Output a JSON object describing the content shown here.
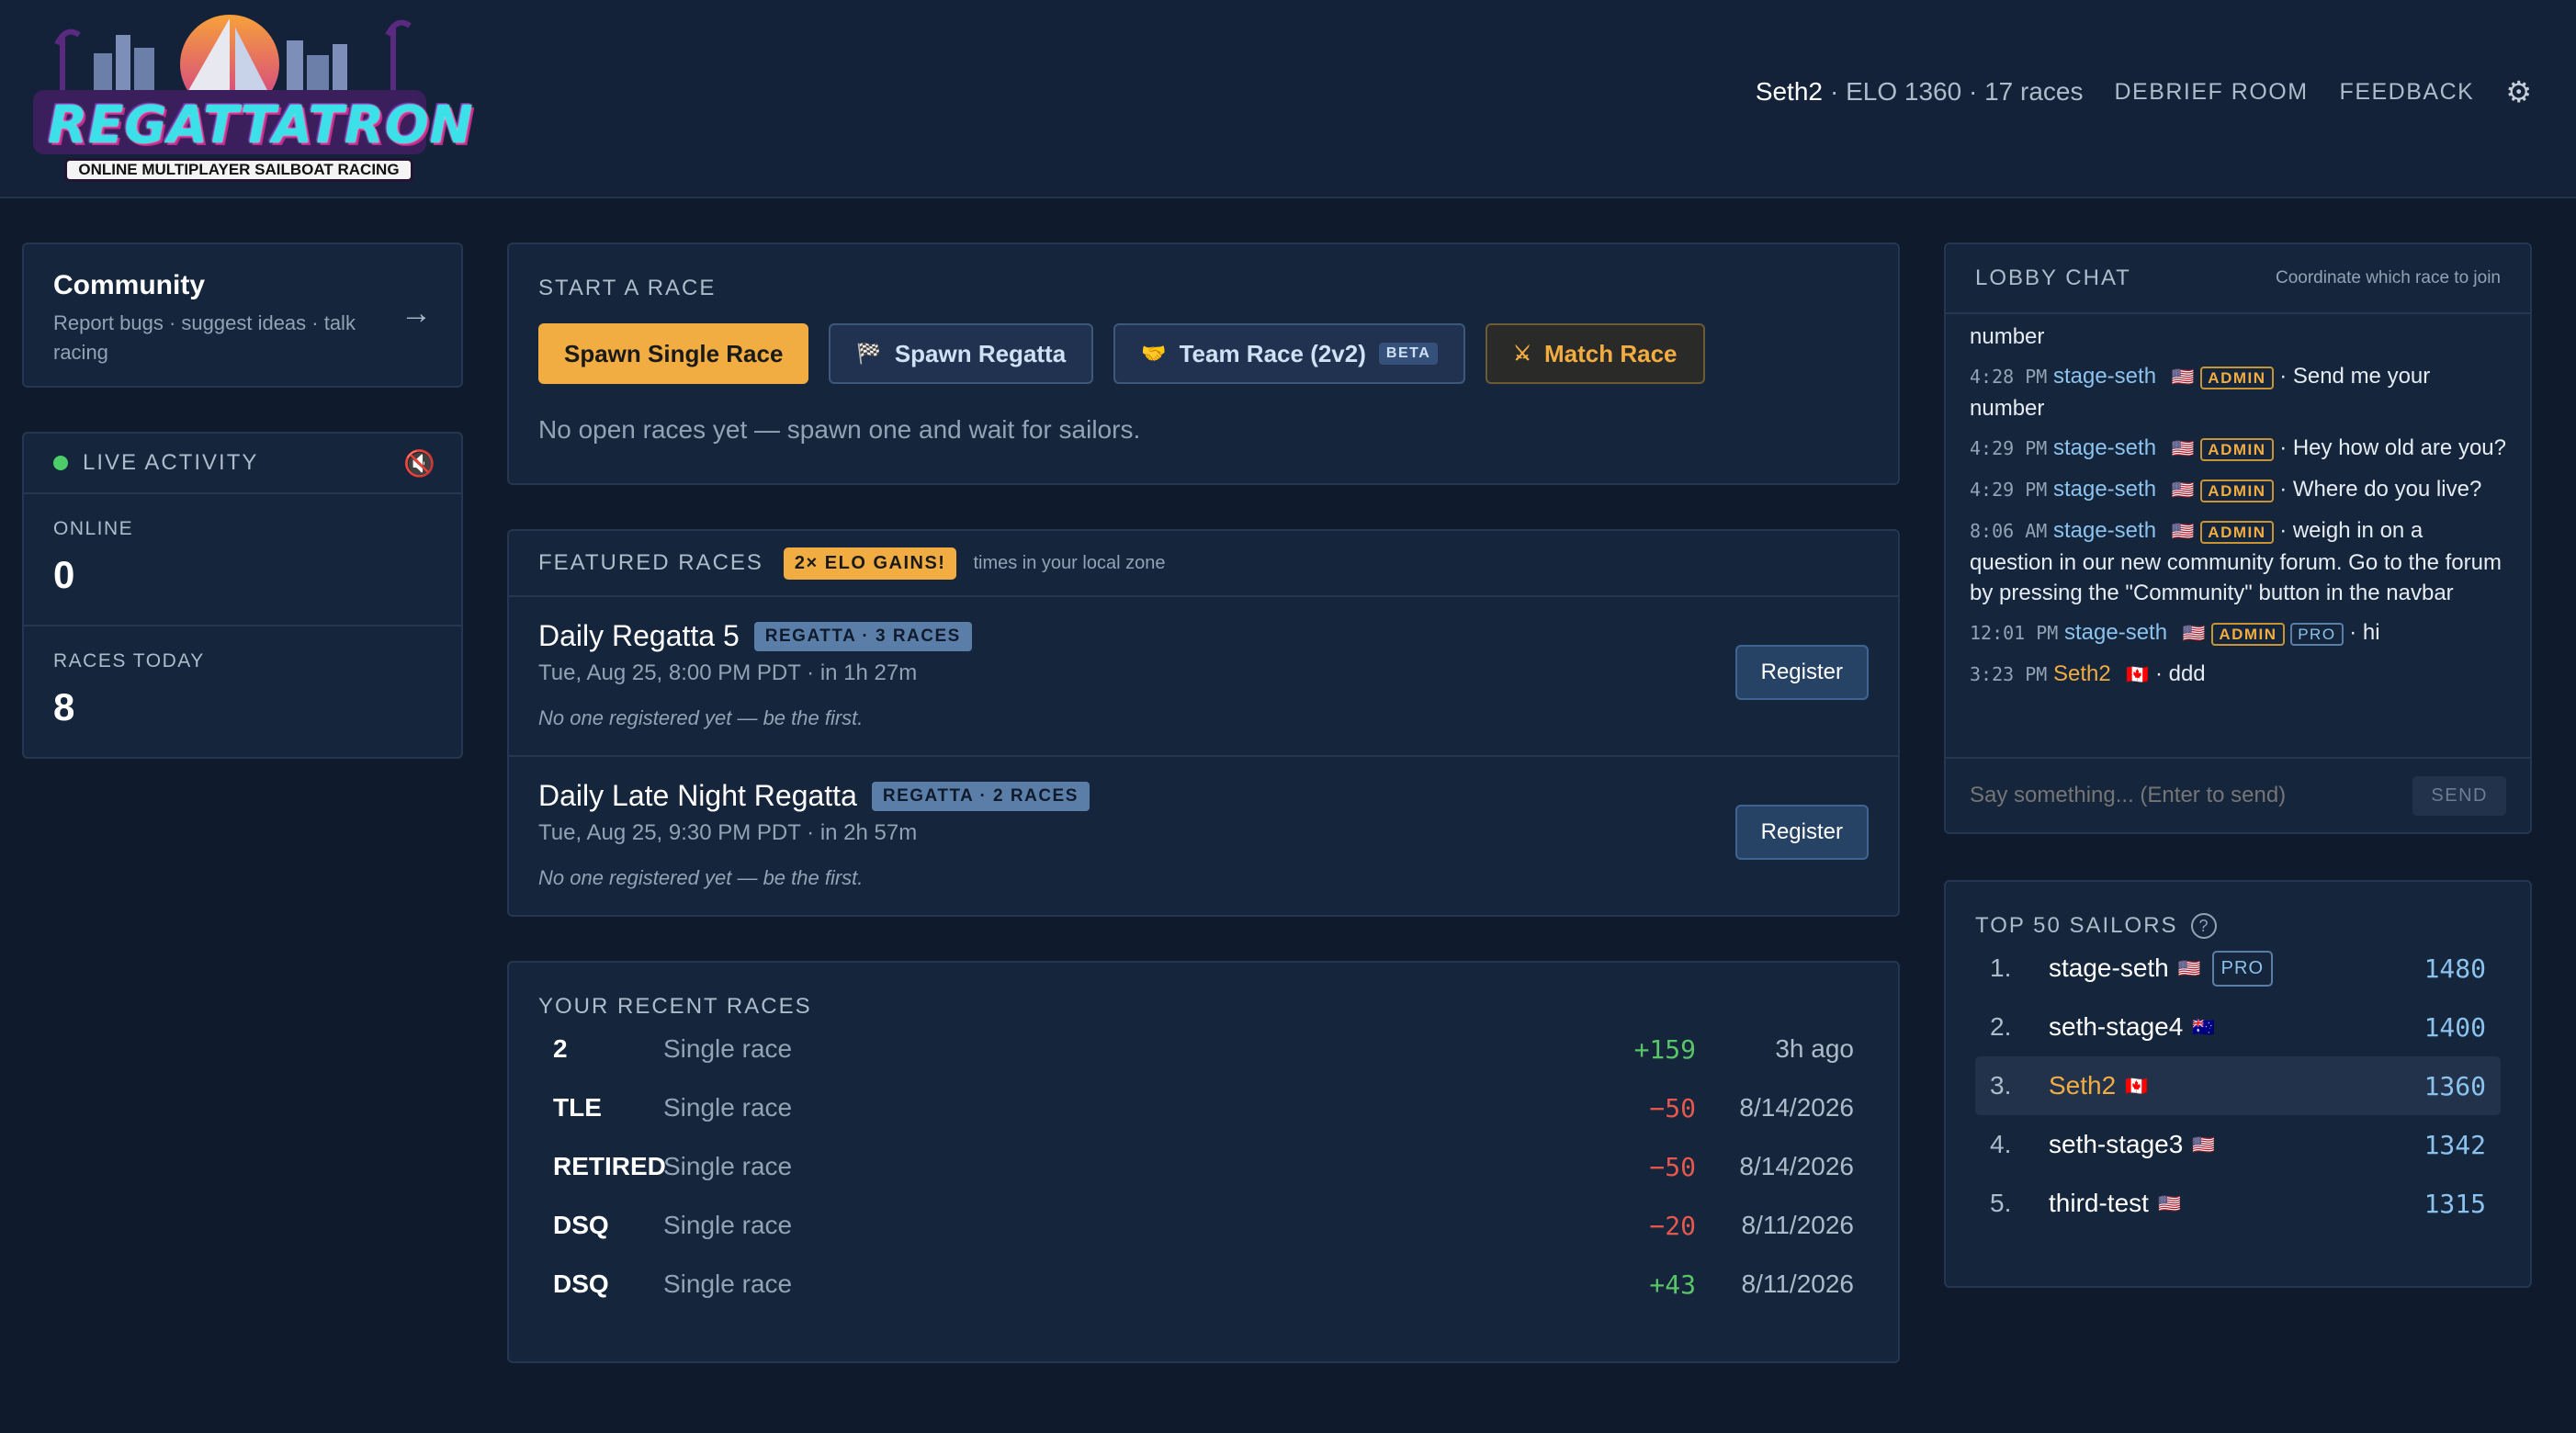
{
  "header": {
    "logo_text": "REGATTATRON",
    "logo_subtitle": "ONLINE MULTIPLAYER SAILBOAT RACING",
    "user_name": "Seth2",
    "user_stats": "· ELO 1360 · 17 races",
    "nav_debrief": "DEBRIEF ROOM",
    "nav_feedback": "FEEDBACK",
    "settings_icon": "gear-icon"
  },
  "community": {
    "title": "Community",
    "subtitle": "Report bugs · suggest ideas · talk racing"
  },
  "live_activity": {
    "title": "LIVE ACTIVITY",
    "online_label": "ONLINE",
    "online_value": "0",
    "races_today_label": "RACES TODAY",
    "races_today_value": "8"
  },
  "start_race": {
    "title": "START A RACE",
    "spawn_single": "Spawn Single Race",
    "spawn_regatta": "Spawn Regatta",
    "team_race": "Team Race (2v2)",
    "team_race_badge": "BETA",
    "match_race": "Match Race",
    "empty_message": "No open races yet — spawn one and wait for sailors."
  },
  "featured": {
    "title": "FEATURED RACES",
    "badge": "2× ELO GAINS!",
    "tz_note": "times in your local zone",
    "races": [
      {
        "name": "Daily Regatta 5",
        "badge": "REGATTA · 3 RACES",
        "time": "Tue, Aug 25, 8:00 PM PDT · in 1h 27m",
        "note": "No one registered yet — be the first.",
        "button": "Register"
      },
      {
        "name": "Daily Late Night Regatta",
        "badge": "REGATTA · 2 RACES",
        "time": "Tue, Aug 25, 9:30 PM PDT · in 2h 57m",
        "note": "No one registered yet — be the first.",
        "button": "Register"
      }
    ]
  },
  "recent": {
    "title": "YOUR RECENT RACES",
    "rows": [
      {
        "result": "2",
        "kind": "Single race",
        "delta": "+159",
        "when": "3h ago",
        "positive": true
      },
      {
        "result": "TLE",
        "kind": "Single race",
        "delta": "−50",
        "when": "8/14/2026",
        "positive": false
      },
      {
        "result": "RETIRED",
        "kind": "Single race",
        "delta": "−50",
        "when": "8/14/2026",
        "positive": false
      },
      {
        "result": "DSQ",
        "kind": "Single race",
        "delta": "−20",
        "when": "8/11/2026",
        "positive": false
      },
      {
        "result": "DSQ",
        "kind": "Single race",
        "delta": "+43",
        "when": "8/11/2026",
        "positive": true
      }
    ]
  },
  "chat": {
    "title": "LOBBY CHAT",
    "subtitle": "Coordinate which race to join",
    "partial_top": "number",
    "messages": [
      {
        "time": "4:28 PM",
        "user": "stage-seth",
        "flag": "🇺🇸",
        "admin": "ADMIN",
        "text": "· Send me your number"
      },
      {
        "time": "4:29 PM",
        "user": "stage-seth",
        "flag": "🇺🇸",
        "admin": "ADMIN",
        "text": "· Hey how old are you?"
      },
      {
        "time": "4:29 PM",
        "user": "stage-seth",
        "flag": "🇺🇸",
        "admin": "ADMIN",
        "text": "· Where do you live?"
      },
      {
        "time": "8:06 AM",
        "user": "stage-seth",
        "flag": "🇺🇸",
        "admin": "ADMIN",
        "text": "· weigh in on a question in our new community forum. Go to the forum by pressing the \"Community\" button in the navbar"
      },
      {
        "time": "12:01 PM",
        "user": "stage-seth",
        "flag": "🇺🇸",
        "admin": "ADMIN",
        "pro": "PRO",
        "text": "· hi"
      },
      {
        "time": "3:23 PM",
        "user": "Seth2",
        "flag": "🇨🇦",
        "self": true,
        "text": "· ddd"
      }
    ],
    "input_placeholder": "Say something... (Enter to send)",
    "send_label": "SEND"
  },
  "top_sailors": {
    "title": "TOP 50 SAILORS",
    "help": "?",
    "rows": [
      {
        "rank": "1.",
        "name": "stage-seth",
        "flag": "🇺🇸",
        "pro": "PRO",
        "score": "1480"
      },
      {
        "rank": "2.",
        "name": "seth-stage4",
        "flag": "🇦🇺",
        "score": "1400"
      },
      {
        "rank": "3.",
        "name": "Seth2",
        "flag": "🇨🇦",
        "score": "1360",
        "me": true
      },
      {
        "rank": "4.",
        "name": "seth-stage3",
        "flag": "🇺🇸",
        "score": "1342"
      },
      {
        "rank": "5.",
        "name": "third-test",
        "flag": "🇺🇸",
        "score": "1315"
      }
    ]
  }
}
